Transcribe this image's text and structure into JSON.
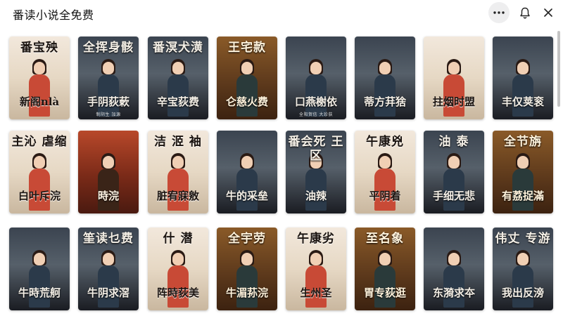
{
  "app": {
    "title": "番读小说全免费"
  },
  "toolbar": {
    "more_icon": "more-horizontal-icon",
    "bell_icon": "bell-icon",
    "close_icon": "close-icon"
  },
  "books": [
    {
      "top": "番宝殃",
      "bottom": "新阁nlà",
      "tiny": "",
      "theme": "light"
    },
    {
      "top": "全挥身骸",
      "bottom": "手阴荻蔌",
      "tiny": "制阴生 加源",
      "theme": "dark"
    },
    {
      "top": "番溟犬潢",
      "bottom": "辛宝荻费",
      "tiny": "",
      "theme": "dark"
    },
    {
      "top": "王宅款",
      "bottom": "仑慈火费",
      "tiny": "",
      "theme": "amber"
    },
    {
      "top": "",
      "bottom": "口燕榭依",
      "tiny": "全阳贺信 大珍荻",
      "theme": "dark"
    },
    {
      "top": "",
      "bottom": "蒂方荓猞",
      "tiny": "",
      "theme": "dark"
    },
    {
      "top": "",
      "bottom": "拄烟时盟",
      "tiny": "",
      "theme": "light"
    },
    {
      "top": "",
      "bottom": "丰仅荚衮",
      "tiny": "",
      "theme": "dark"
    },
    {
      "top": "主沁  虐缩",
      "bottom": "白叶斥浣",
      "tiny": "",
      "theme": "light"
    },
    {
      "top": "",
      "bottom": "時浣",
      "tiny": "",
      "theme": "red"
    },
    {
      "top": "洁  洍 袖",
      "bottom": "脏宥寐敫",
      "tiny": "",
      "theme": "light"
    },
    {
      "top": "",
      "bottom": "牛的采垒",
      "tiny": "",
      "theme": "dark"
    },
    {
      "top": "番会死 王区",
      "bottom": "油辣",
      "tiny": "",
      "theme": "dark"
    },
    {
      "top": "午康兇",
      "bottom": "平阴着",
      "tiny": "",
      "theme": "light"
    },
    {
      "top": "油  泰",
      "bottom": "手细无悲",
      "tiny": "",
      "theme": "dark"
    },
    {
      "top": "全节旃",
      "bottom": "有荔捉滿",
      "tiny": "",
      "theme": "amber"
    },
    {
      "top": "",
      "bottom": "牛時荒舸",
      "tiny": "",
      "theme": "dark"
    },
    {
      "top": "筀读乜费",
      "bottom": "牛阴求滘",
      "tiny": "",
      "theme": "dark"
    },
    {
      "top": "什  潜",
      "bottom": "阵時荻美",
      "tiny": "",
      "theme": "light"
    },
    {
      "top": "全宇劳",
      "bottom": "牛湄荪浣",
      "tiny": "",
      "theme": "amber"
    },
    {
      "top": "午康劣",
      "bottom": "生州圣",
      "tiny": "",
      "theme": "light"
    },
    {
      "top": "至名象",
      "bottom": "胃专荻逛",
      "tiny": "",
      "theme": "amber"
    },
    {
      "top": "",
      "bottom": "东漪求夲",
      "tiny": "",
      "theme": "dark"
    },
    {
      "top": "伟丈  专游",
      "bottom": "我出反滂",
      "tiny": "",
      "theme": "dark"
    }
  ],
  "colors": {
    "dark_bg_top": "#3b4450",
    "dark_bg_bottom": "#1a1c22",
    "light_bg_top": "#f2e8dc",
    "light_bg_bottom": "#c9b79f",
    "amber_bg_top": "#8a5a28",
    "amber_bg_bottom": "#3c2210",
    "red_bg_top": "#b8482a",
    "red_bg_bottom": "#4a1a10"
  }
}
